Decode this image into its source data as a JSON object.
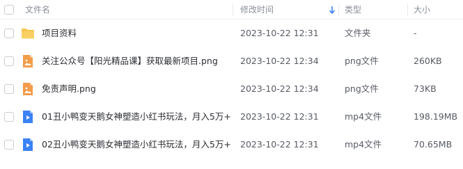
{
  "header": {
    "name_label": "文件名",
    "time_label": "修改时间",
    "type_label": "类型",
    "size_label": "大小"
  },
  "colors": {
    "folder": "#f5c44c",
    "image_file": "#f39c4a",
    "video_file": "#3b82f6",
    "sort_arrow": "#3b82f6"
  },
  "rows": [
    {
      "icon": "folder-icon",
      "name": "项目资料",
      "time": "2023-10-22 12:31",
      "type": "文件夹",
      "size": "-"
    },
    {
      "icon": "image-file-icon",
      "name": "关注公众号【阳光精品课】获取最新项目.png",
      "time": "2023-10-22 12:34",
      "type": "png文件",
      "size": "260KB"
    },
    {
      "icon": "image-file-icon",
      "name": "免责声明.png",
      "time": "2023-10-22 12:34",
      "type": "png文件",
      "size": "73KB"
    },
    {
      "icon": "video-file-icon",
      "name": "01丑小鸭变天鹅女神塑造小红书玩法，月入5万+...",
      "time": "2023-10-22 12:31",
      "type": "mp4文件",
      "size": "198.19MB"
    },
    {
      "icon": "video-file-icon",
      "name": "02丑小鸭变天鹅女神塑造小红书玩法，月入5万+...",
      "time": "2023-10-22 12:31",
      "type": "mp4文件",
      "size": "70.65MB"
    }
  ]
}
